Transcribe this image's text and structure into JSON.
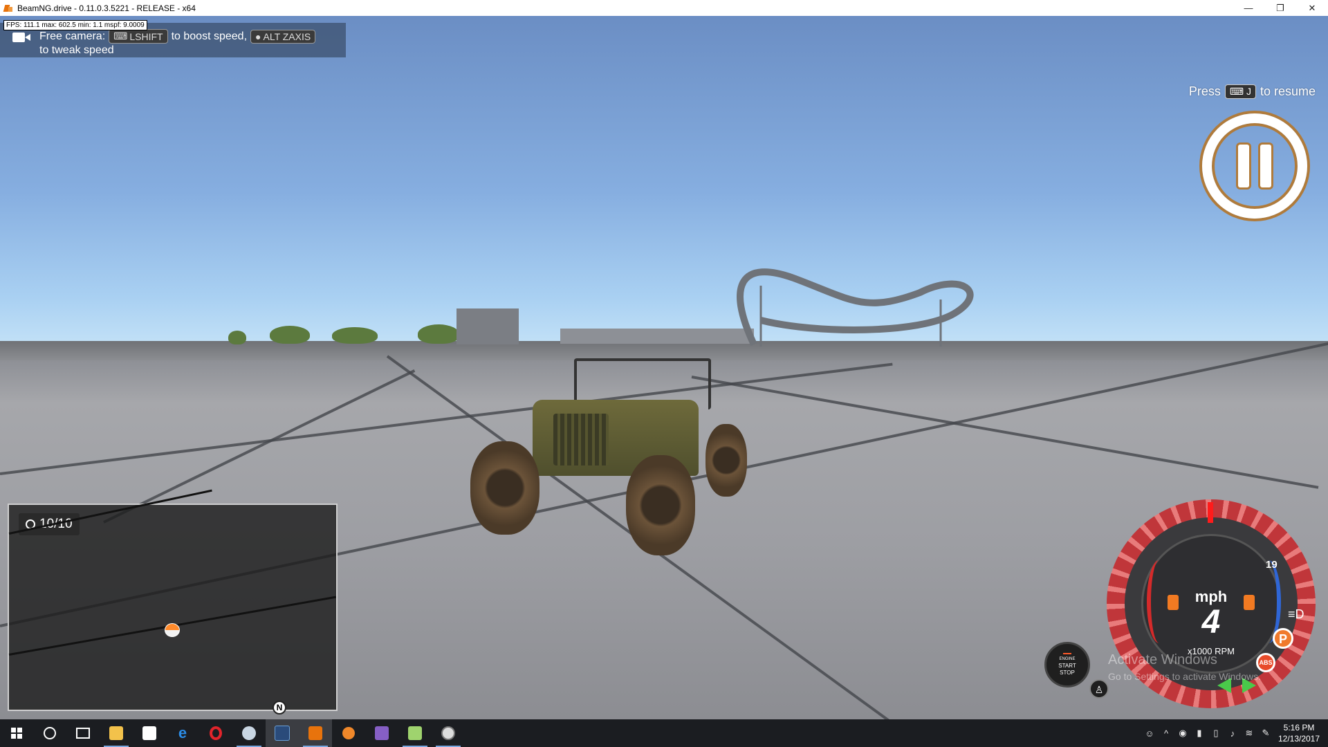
{
  "window": {
    "title": "BeamNG.drive - 0.11.0.3.5221 - RELEASE - x64",
    "controls": {
      "minimize": "—",
      "maximize": "❐",
      "close": "✕"
    }
  },
  "hud": {
    "fps": "FPS: 111.1  max: 602.5  min: 1.1  mspf: 9.0009",
    "camera": {
      "label": "Free camera:",
      "boost_key": "LSHIFT",
      "boost_text": "to boost speed,",
      "axis_key": "ALT ZAXIS",
      "tweak_text": "to tweak speed"
    },
    "resume": {
      "prefix": "Press",
      "key": "J",
      "suffix": "to resume"
    }
  },
  "minimap": {
    "counter": "10/10",
    "north": "N"
  },
  "dashboard": {
    "engine_top": "ENGINE",
    "engine_start": "START",
    "engine_stop": "STOP",
    "unit": "mph",
    "speed": "4",
    "rpm_label": "x1000 RPM",
    "gear": "19",
    "park": "P",
    "abs": "ABS",
    "accent": "#f07a2c"
  },
  "watermark": {
    "title": "Activate Windows",
    "subtitle": "Go to Settings to activate Windows."
  },
  "taskbar": {
    "apps": [
      "start-icon",
      "cortana-icon",
      "task-view-icon",
      "file-explorer-icon",
      "store-icon",
      "edge-icon",
      "opera-icon",
      "steam-icon",
      "app-icon",
      "beamng-icon",
      "blender-icon",
      "visual-studio-icon",
      "notepad-icon",
      "game-icon"
    ],
    "time": "5:16 PM",
    "date": "12/13/2017"
  }
}
